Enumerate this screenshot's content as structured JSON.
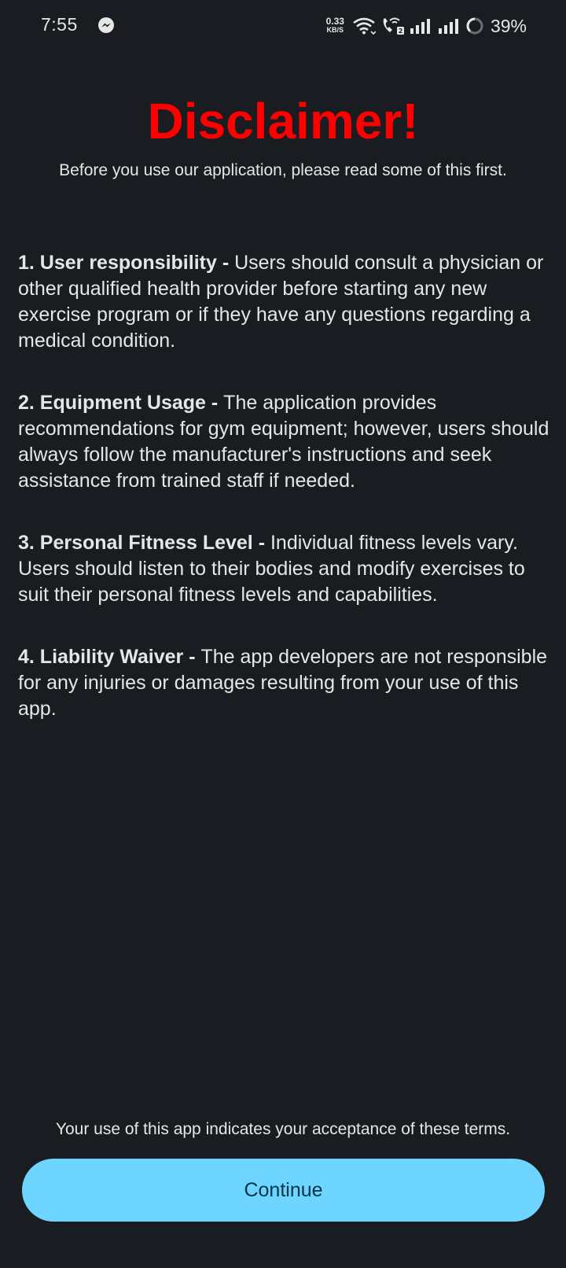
{
  "status_bar": {
    "time": "7:55",
    "net_speed_value": "0.33",
    "net_speed_unit": "KB/S",
    "battery": "39%",
    "icons": [
      "messenger-icon",
      "wifi-icon",
      "wifi-call-icon",
      "signal-icon",
      "signal-icon",
      "battery-icon"
    ]
  },
  "header": {
    "title": "Disclaimer!",
    "subtitle": "Before you use our application, please read some of this first."
  },
  "terms": [
    {
      "heading": "1. User responsibility - ",
      "body": "Users should consult a physician or other qualified health provider before starting any new exercise program or if they have any questions regarding a medical condition."
    },
    {
      "heading": "2. Equipment Usage - ",
      "body": "The application provides recommendations for gym equipment; however, users should always follow the manufacturer's instructions and seek assistance from trained staff if needed."
    },
    {
      "heading": "3. Personal Fitness Level - ",
      "body": "Individual fitness levels vary. Users should listen to their bodies and modify exercises to suit their personal fitness levels and capabilities."
    },
    {
      "heading": "4. Liability Waiver - ",
      "body": "The app developers are not responsible for any injuries or damages resulting from your use of this app."
    }
  ],
  "footer": {
    "acceptance": "Your use of this app indicates your acceptance of these terms.",
    "continue_label": "Continue"
  },
  "colors": {
    "background": "#191c20",
    "title": "#ff0000",
    "button": "#6dd5ff",
    "button_text": "#003547"
  }
}
